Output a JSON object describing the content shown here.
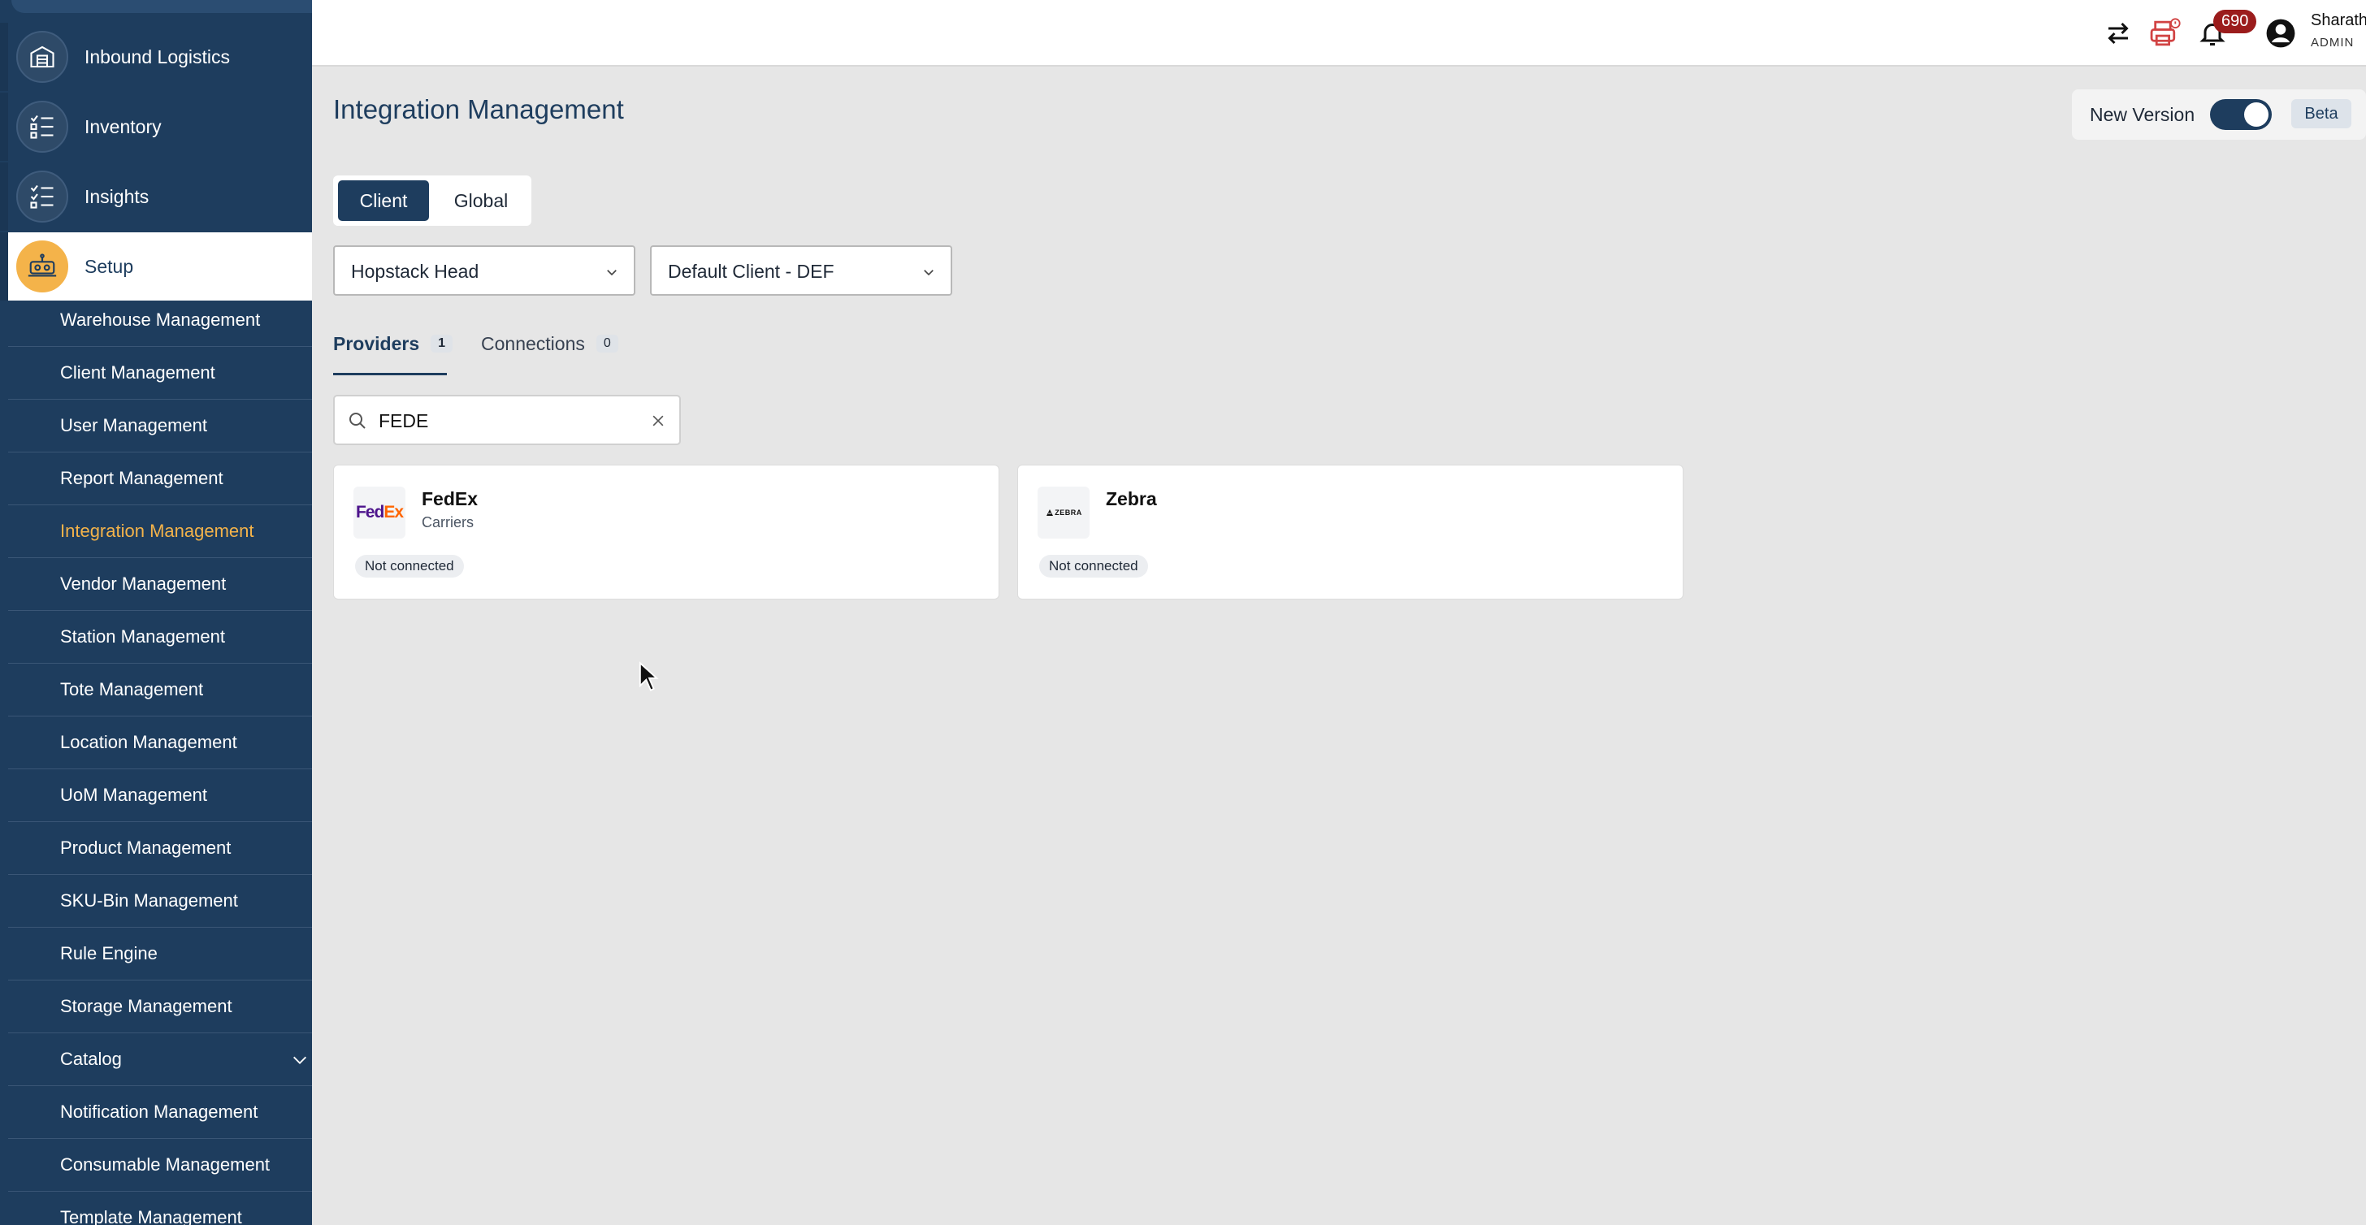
{
  "sidebar": {
    "nav": [
      {
        "label": "Inbound Logistics",
        "icon": "warehouse-icon"
      },
      {
        "label": "Inventory",
        "icon": "checklist-icon"
      },
      {
        "label": "Insights",
        "icon": "checklist-icon"
      },
      {
        "label": "Setup",
        "icon": "robot-icon",
        "active": true
      }
    ],
    "setup_items": [
      "Warehouse Management",
      "Client Management",
      "User Management",
      "Report Management",
      "Integration Management",
      "Vendor Management",
      "Station Management",
      "Tote Management",
      "Location Management",
      "UoM Management",
      "Product Management",
      "SKU-Bin Management",
      "Rule Engine",
      "Storage Management",
      "Catalog",
      "Notification Management",
      "Consumable Management",
      "Template Management"
    ],
    "active_item": "Integration Management"
  },
  "topbar": {
    "notification_count": "690",
    "user_name": "Sharath",
    "user_role": "ADMIN"
  },
  "page": {
    "title": "Integration Management",
    "new_version_label": "New Version",
    "new_version_on": true,
    "beta_label": "Beta",
    "segment": {
      "client": "Client",
      "global": "Global",
      "selected": "Client"
    },
    "warehouse_select": "Hopstack Head",
    "client_select": "Default Client - DEF",
    "tabs": [
      {
        "label": "Providers",
        "count": "1",
        "active": true
      },
      {
        "label": "Connections",
        "count": "0",
        "active": false
      }
    ],
    "search": {
      "value": "FEDE"
    },
    "providers": [
      {
        "name": "FedEx",
        "category": "Carriers",
        "status": "Not connected",
        "logo": "fedex-logo"
      },
      {
        "name": "Zebra",
        "category": "",
        "status": "Not connected",
        "logo": "zebra-logo"
      }
    ],
    "logo_text": {
      "fed": "Fed",
      "ex": "Ex",
      "zebra": "ZEBRA"
    }
  },
  "colors": {
    "sidebar": "#1e3d5e",
    "accent": "#f4b34a",
    "primary": "#1e3d5e",
    "alert": "#9b1c1c",
    "background": "#e6e6e6"
  }
}
